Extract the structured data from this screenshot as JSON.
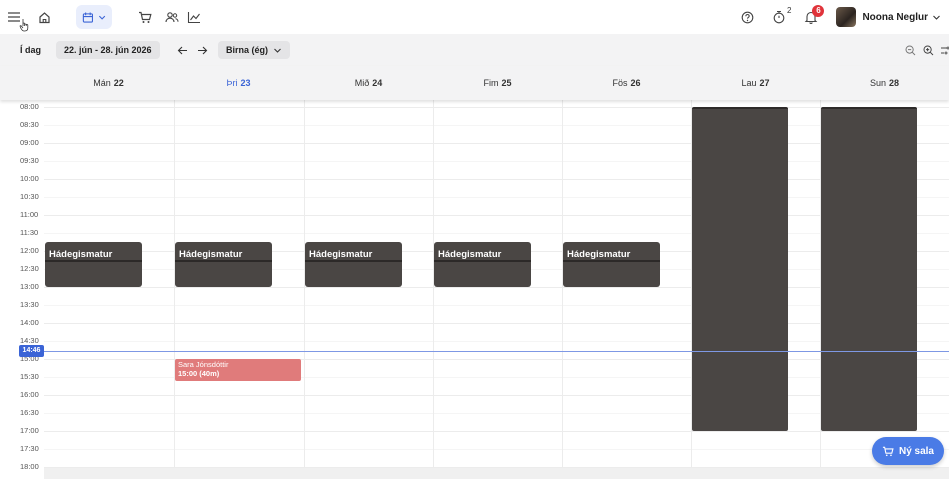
{
  "nav": {
    "icons": [
      "menu-icon",
      "home-icon",
      "calendar-icon",
      "cart-icon",
      "users-icon",
      "chart-icon"
    ],
    "help_icon": "help-icon",
    "tasks_badge": "2",
    "notifications_badge": "6",
    "user_name": "Noona Neglur"
  },
  "toolbar": {
    "today_label": "Í dag",
    "date_range": "22. jún - 28. jún 2026",
    "staff_label": "Birna (ég)"
  },
  "days": [
    {
      "name": "Mán",
      "num": "22"
    },
    {
      "name": "Þri",
      "num": "23"
    },
    {
      "name": "Mið",
      "num": "24"
    },
    {
      "name": "Fim",
      "num": "25"
    },
    {
      "name": "Fös",
      "num": "26"
    },
    {
      "name": "Lau",
      "num": "27"
    },
    {
      "name": "Sun",
      "num": "28"
    }
  ],
  "today_index": 1,
  "times": [
    "08:00",
    "08:30",
    "09:00",
    "09:30",
    "10:00",
    "10:30",
    "11:00",
    "11:30",
    "12:00",
    "12:30",
    "13:00",
    "13:30",
    "14:00",
    "14:30",
    "15:00",
    "15:30",
    "16:00",
    "16:30",
    "17:00",
    "17:30",
    "18:00"
  ],
  "lunch_label": "Hádegismatur",
  "lunch_days": [
    0,
    1,
    2,
    3,
    4
  ],
  "appointment": {
    "name": "Sara Jónsdóttir",
    "time": "15:00 (40m)"
  },
  "now_time": "14:46",
  "new_sale_label": "Ný sala",
  "colors": {
    "accent": "#3b64d6",
    "blocked": "#4a4644",
    "appointment": "#e07b7b",
    "button": "#4a7be6"
  }
}
